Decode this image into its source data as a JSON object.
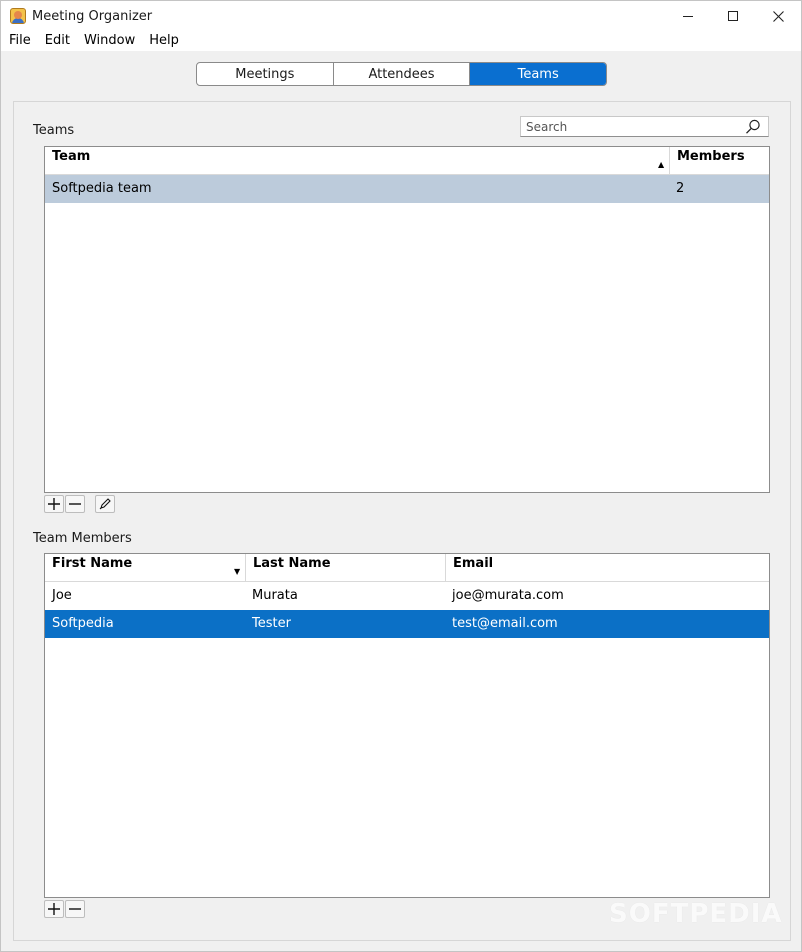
{
  "window": {
    "title": "Meeting Organizer"
  },
  "menu": [
    "File",
    "Edit",
    "Window",
    "Help"
  ],
  "tabs": [
    {
      "label": "Meetings",
      "active": false
    },
    {
      "label": "Attendees",
      "active": false
    },
    {
      "label": "Teams",
      "active": true
    }
  ],
  "teams_section": {
    "label": "Teams",
    "search_placeholder": "Search",
    "columns": [
      {
        "label": "Team",
        "sort": "ascending"
      },
      {
        "label": "Members"
      }
    ],
    "rows": [
      {
        "team": "Softpedia team",
        "members": "2",
        "selected": true
      }
    ]
  },
  "members_section": {
    "label": "Team Members",
    "columns": [
      {
        "label": "First Name",
        "sort": "descending"
      },
      {
        "label": "Last Name"
      },
      {
        "label": "Email"
      }
    ],
    "rows": [
      {
        "first": "Joe",
        "last": "Murata",
        "email": "joe@murata.com",
        "selected": false
      },
      {
        "first": "Softpedia",
        "last": "Tester",
        "email": "test@email.com",
        "selected": true
      }
    ]
  },
  "watermark": "SOFTPEDIA",
  "colors": {
    "accent": "#0a6fd0",
    "row_selected_inactive": "#bccbdb",
    "row_selected_active": "#0b70c6"
  },
  "icons": {
    "add": "plus-icon",
    "remove": "minus-icon",
    "edit": "pencil-icon",
    "search": "magnifier-icon"
  }
}
